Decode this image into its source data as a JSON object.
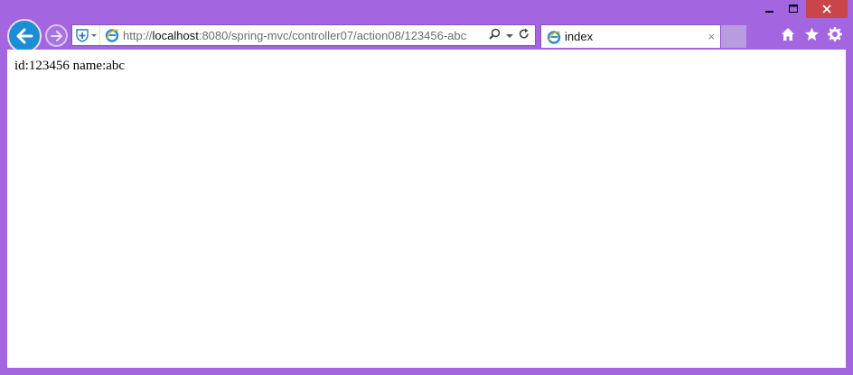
{
  "window": {
    "minimize_icon": "minimize-icon",
    "maximize_icon": "maximize-icon",
    "close_icon": "close-icon"
  },
  "address_bar": {
    "url_prefix": "http://",
    "url_host": "localhost",
    "url_path": ":8080/spring-mvc/controller07/action08/123456-abc"
  },
  "tab": {
    "title": "index",
    "close_glyph": "×"
  },
  "page": {
    "text": "id:123456 name:abc"
  },
  "colors": {
    "chrome": "#a365e0",
    "close_button": "#c9454a",
    "back_button": "#1b8ed6"
  }
}
